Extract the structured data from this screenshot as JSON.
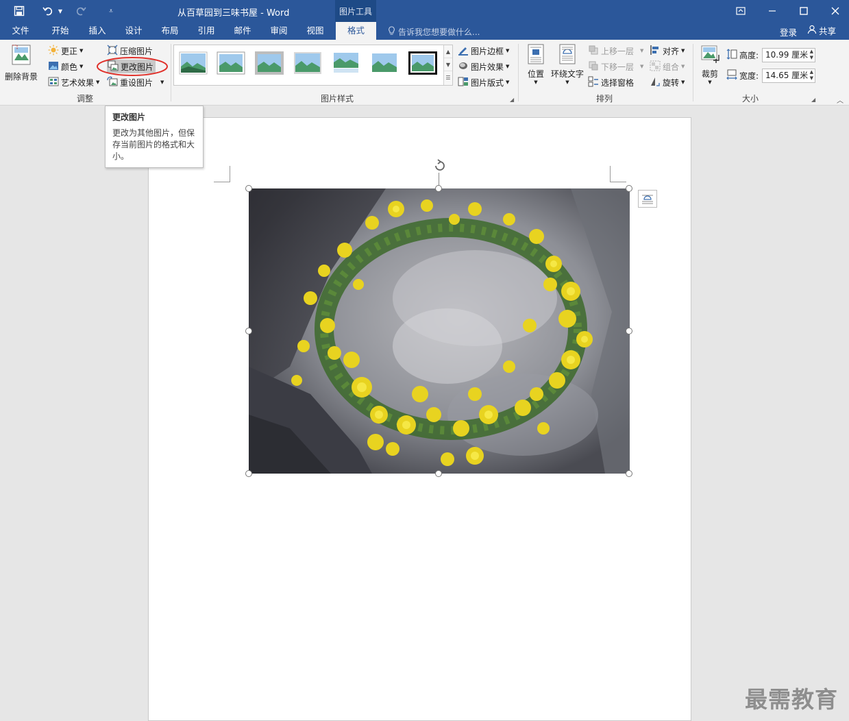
{
  "titlebar": {
    "doc_title": "从百草园到三味书屋 - Word",
    "context_tab": "图片工具"
  },
  "tabs": [
    {
      "label": "文件"
    },
    {
      "label": "开始"
    },
    {
      "label": "插入"
    },
    {
      "label": "设计"
    },
    {
      "label": "布局"
    },
    {
      "label": "引用"
    },
    {
      "label": "邮件"
    },
    {
      "label": "审阅"
    },
    {
      "label": "视图"
    },
    {
      "label": "格式",
      "active": true
    }
  ],
  "tell_me": "告诉我您想要做什么...",
  "account": {
    "login": "登录",
    "share": "共享"
  },
  "ribbon": {
    "adjust": {
      "remove_bg": "删除背景",
      "corrections": "更正",
      "color": "颜色",
      "artistic": "艺术效果",
      "compress": "压缩图片",
      "change": "更改图片",
      "reset": "重设图片",
      "label": "调整"
    },
    "styles": {
      "border": "图片边框",
      "effects": "图片效果",
      "layout": "图片版式",
      "label": "图片样式"
    },
    "arrange": {
      "position": "位置",
      "wrap": "环绕文字",
      "forward": "上移一层",
      "backward": "下移一层",
      "pane": "选择窗格",
      "align": "对齐",
      "group": "组合",
      "rotate": "旋转",
      "label": "排列"
    },
    "size": {
      "crop": "裁剪",
      "height_label": "高度:",
      "height_value": "10.99 厘米",
      "width_label": "宽度:",
      "width_value": "14.65 厘米",
      "label": "大小"
    }
  },
  "tooltip": {
    "title": "更改图片",
    "body": "更改为其他图片，但保存当前图片的格式和大小。"
  },
  "watermark": "最需教育",
  "colors": {
    "title_bar": "#2b579a",
    "ribbon_bg": "#f3f3f3",
    "highlight_circle": "#e0302a"
  }
}
